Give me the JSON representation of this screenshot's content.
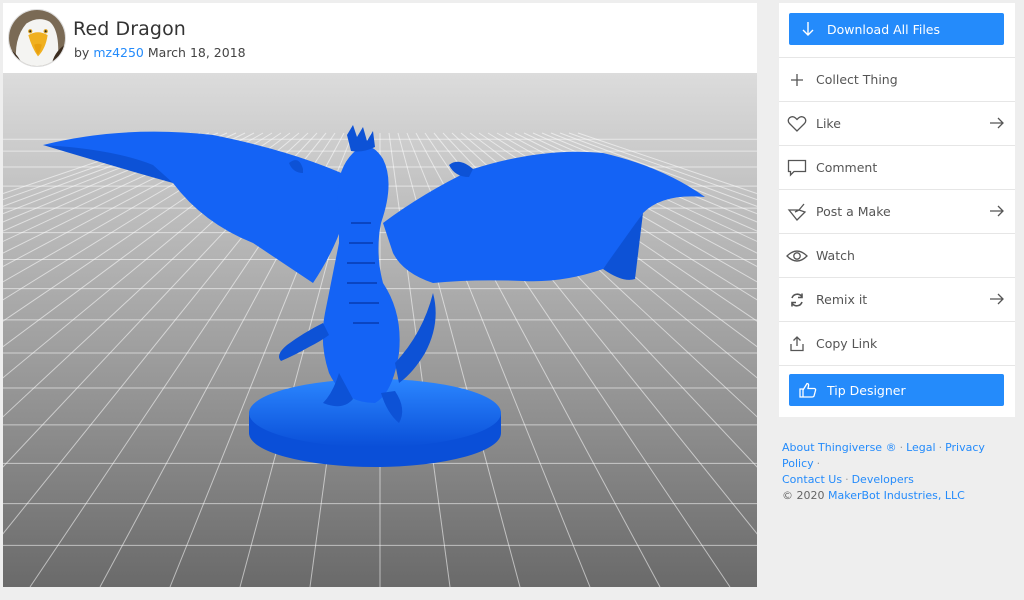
{
  "thing": {
    "title": "Red Dragon",
    "by_prefix": "by",
    "author": "mz4250",
    "date": "March 18, 2018",
    "avatar_icon": "eagle-avatar",
    "model_color": "#1463f5"
  },
  "actions": {
    "download_label": "Download All Files",
    "collect_label": "Collect Thing",
    "like_label": "Like",
    "comment_label": "Comment",
    "post_make_label": "Post a Make",
    "watch_label": "Watch",
    "remix_label": "Remix it",
    "copy_link_label": "Copy Link",
    "tip_label": "Tip Designer"
  },
  "footer": {
    "about": "About Thingiverse ®",
    "legal": "Legal",
    "privacy": "Privacy Policy",
    "contact": "Contact Us",
    "developers": "Developers",
    "copyright": "©  2020",
    "company": "MakerBot Industries, LLC"
  },
  "colors": {
    "accent": "#248bfb",
    "background": "#eeeeee"
  }
}
